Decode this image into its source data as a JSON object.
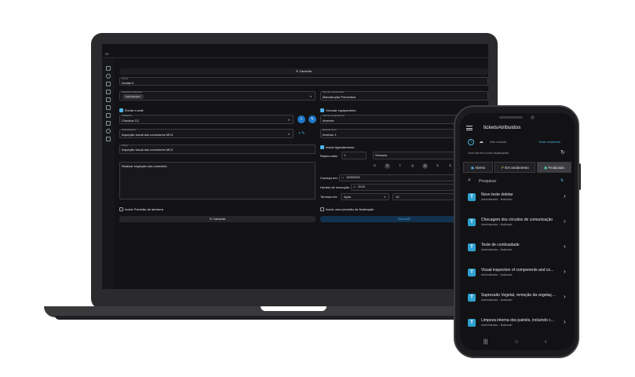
{
  "laptop": {
    "topbar_logo": "05",
    "cancel_top": "✕  Cancelar",
    "form": {
      "name_label": "Nome",
      "name_value": "Avaliar II",
      "users_label": "Usuários atribuídos",
      "users_chip": "Administrador",
      "maint_label": "Tipo de manutenção",
      "maint_value": "Manutenção Preventiva",
      "send_email": "Enviar e-mail",
      "link_equipment": "Vincular equipamento",
      "category_label": "Categoria",
      "category_value": "Circuitos CC",
      "equip_type_label": "Tipo de equipamento",
      "equip_type_value": "Inversor",
      "subcategory_label": "Subcategoria",
      "subcategory_value": "Inspeção visual dos conectores MC4",
      "equipment_label": "Equipamento",
      "equipment_value": "Inversor 1",
      "title_label": "Título",
      "title_value": "Inspeção visual dos conectores MC4",
      "include_schedule": "Incluir Agendamento",
      "repeat_label": "Repita cada:",
      "repeat_value": "1",
      "repeat_unit": "Semana",
      "description": "Realizar inspeção nas conexões",
      "days": [
        "D",
        "S",
        "T",
        "Q",
        "Q",
        "S",
        "S"
      ],
      "start_label": "Começa em:",
      "start_value": "15/09/2024",
      "time_label": "Horário de execução:",
      "time_value": "20:20",
      "ends_label": "Termina em:",
      "ends_value": "Após",
      "ends_count": "10",
      "include_open_forecast": "Incluir Previsão de abertura",
      "include_close_forecast": "Incluir uma previsão de finalização",
      "cancel_button": "✕  Cancelar",
      "save_button": "SALVAR"
    }
  },
  "phone": {
    "title": "ticketsAtribuidos",
    "sync_text": "Sem conexão",
    "sync_link": "Tentar novamente",
    "info_text": "Você não tem novas atualizações",
    "tabs": [
      "Aberto",
      "Em andamento",
      "Finalizado"
    ],
    "search_placeholder": "Pesquisar",
    "items": [
      {
        "title": "Novo teste deletar",
        "subtitle": "Administrador - finalizado"
      },
      {
        "title": "Checagem dos circuitos de comunicação",
        "subtitle": "Administrador - finalizado"
      },
      {
        "title": "Teste de continuidade",
        "subtitle": "Administrador - finalizado"
      },
      {
        "title": "Visual inspection of components and co...",
        "subtitle": "Administrador - finalizado"
      },
      {
        "title": "Supressão Vegetal, remoção da vegetaç...",
        "subtitle": "Administrador - finalizado"
      },
      {
        "title": "Limpeza interna dos painéis, incluindo c...",
        "subtitle": "Administrador - finalizado"
      }
    ],
    "nav": [
      "|||",
      "○",
      "‹"
    ]
  },
  "colors": {
    "accent": "#1f78c8",
    "checkbox": "#4fb3e8",
    "ticket_icon": "#2ea0cf"
  }
}
